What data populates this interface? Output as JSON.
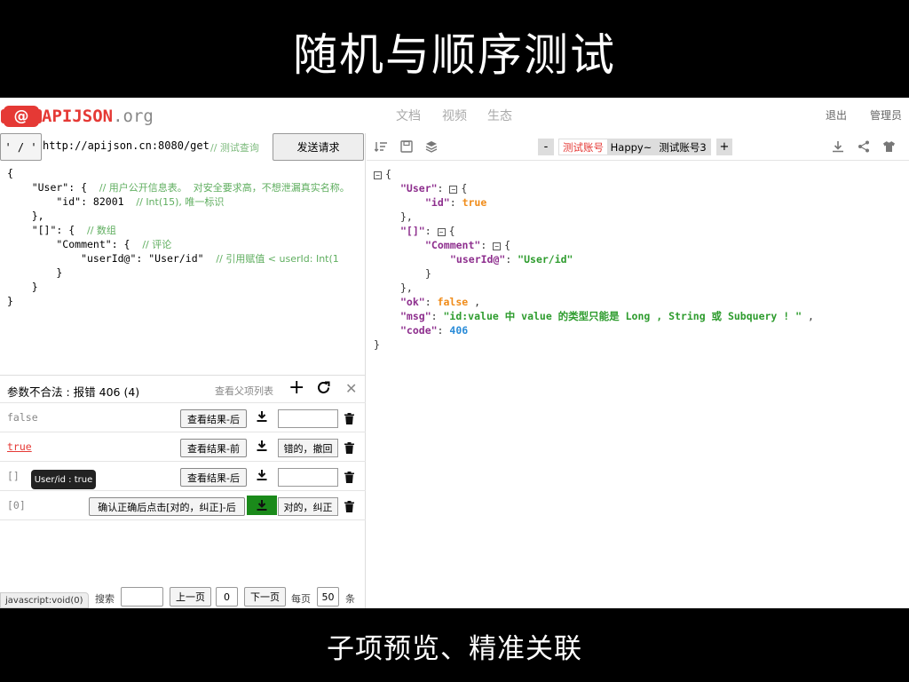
{
  "slide": {
    "title": "随机与顺序测试",
    "subtitle": "子项预览、精准关联"
  },
  "header": {
    "logo_at": "@",
    "logo_name": "APIJSON",
    "logo_org": ".org",
    "nav": [
      "文档",
      "视频",
      "生态"
    ],
    "logout": "退出",
    "admin": "管理员"
  },
  "request": {
    "method": "' / '",
    "url": "http://apijson.cn:8080/get",
    "url_comment": "// 测试查询",
    "send_label": "发送请求",
    "code_lines": [
      {
        "code": "{",
        "comment": ""
      },
      {
        "code": "    \"User\": {  ",
        "comment": "// 用户公开信息表。  对安全要求高，不想泄漏真实名称。"
      },
      {
        "code": "        \"id\": 82001  ",
        "comment": "// Int(15), 唯一标识"
      },
      {
        "code": "    },",
        "comment": ""
      },
      {
        "code": "    \"[]\": {  ",
        "comment": "// 数组"
      },
      {
        "code": "        \"Comment\": {  ",
        "comment": "// 评论"
      },
      {
        "code": "            \"userId@\": \"User/id\"  ",
        "comment": "// 引用赋值 < userId: Int(1"
      },
      {
        "code": "        }",
        "comment": ""
      },
      {
        "code": "    }",
        "comment": ""
      },
      {
        "code": "}",
        "comment": ""
      }
    ]
  },
  "random_test": {
    "title": "参数不合法 : 报错 406 (4)",
    "parent_list": "查看父项列表",
    "add_icon": "plus-icon",
    "refresh_icon": "refresh-icon",
    "close_icon": "close-icon",
    "rows": [
      {
        "value": "false",
        "button": "查看结果-后",
        "box": ""
      },
      {
        "value": "true",
        "button": "查看结果-前",
        "box": "错的，撤回"
      },
      {
        "value": "[]",
        "button": "查看结果-后",
        "box": ""
      },
      {
        "value": "[0]",
        "button": "确认正确后点击[对的，纠正]-后",
        "box": "对的，纠正"
      }
    ],
    "tooltip": "User/id : true"
  },
  "pager": {
    "search_label": "搜索",
    "search_value": "",
    "prev": "上一页",
    "page": "0",
    "next": "下一页",
    "per_page_label": "每页",
    "per_page": "50",
    "unit": "条"
  },
  "status_bar": "javascript:void(0)",
  "accounts": {
    "minus": "-",
    "active": "测试账号",
    "tabs": [
      "Happy~",
      "测试账号3"
    ],
    "plus": "+"
  },
  "response": {
    "msg": "\"id:value 中 value 的类型只能是 Long , String 或 Subquery ! \"",
    "ok": "false",
    "code": "406",
    "user_id": "true",
    "user_id_ref": "\"User/id\""
  },
  "colors": {
    "brand": "#e53935",
    "green": "#1a8a1a",
    "key": "#8e2f8e",
    "string": "#2e9c2e",
    "number": "#2a8cd8",
    "boolean": "#f08c1a"
  }
}
